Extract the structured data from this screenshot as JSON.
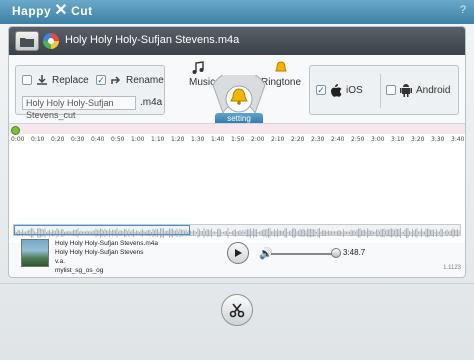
{
  "app": {
    "title_left": "Happy",
    "title_right": "Cut",
    "help": "?"
  },
  "file": {
    "name": "Holy Holy Holy-Sufjan Stevens.m4a"
  },
  "output": {
    "replace_label": "Replace",
    "rename_label": "Rename",
    "rename_checked": true,
    "filename_value": "Holy Holy Holy-Sufjan Stevens_cut",
    "extension": ".m4a"
  },
  "mode": {
    "music_label": "Music",
    "ringtone_label": "Ringtone",
    "setting_tab": "setting"
  },
  "device": {
    "ios_label": "iOS",
    "ios_checked": true,
    "android_label": "Android",
    "android_checked": false
  },
  "ruler": [
    "0:00",
    "0:10",
    "0:20",
    "0:30",
    "0:40",
    "0:50",
    "1:00",
    "1:10",
    "1:20",
    "1:30",
    "1:40",
    "1:50",
    "2:00",
    "2:10",
    "2:20",
    "2:30",
    "2:40",
    "2:50",
    "3:00",
    "3:10",
    "3:20",
    "3:30",
    "3:40"
  ],
  "player": {
    "line1": "Holy Holy Holy-Sufjan Stevens.m4a",
    "line2": "Holy Holy Holy-Sufjan Stevens",
    "line3": "v.a.",
    "line4": "mylist_sg_os_og",
    "time": "3:48.7",
    "version": "1.1123"
  },
  "colors": {
    "wave_top": "#8bd84b",
    "wave_bottom": "#3fb8d6",
    "accent": "#3d80a5"
  }
}
